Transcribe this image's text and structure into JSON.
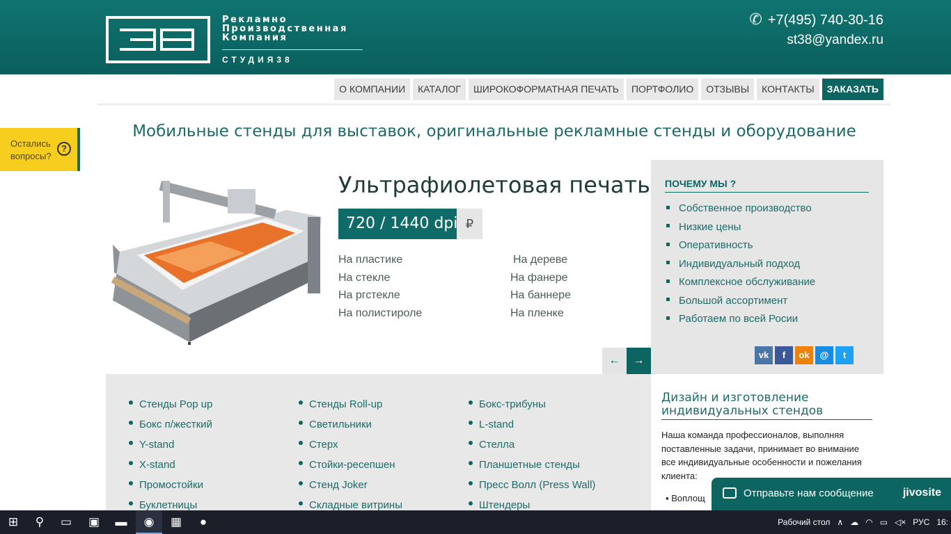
{
  "header": {
    "logo_lines": [
      "Рекламно",
      "Производственная",
      "Компания"
    ],
    "logo_sub": "СТУДИЯ38",
    "phone": "+7(495) 740-30-16",
    "email": "st38@yandex.ru"
  },
  "nav": {
    "items": [
      "О КОМПАНИИ",
      "КАТАЛОГ",
      "ШИРОКОФОРМАТНАЯ ПЕЧАТЬ",
      "ПОРТФОЛИО",
      "ОТЗЫВЫ",
      "КОНТАКТЫ",
      "ЗАКАЗАТЬ"
    ]
  },
  "side_tab": {
    "label_line1": "Остались",
    "label_line2": "вопросы?",
    "icon": "?"
  },
  "headline": "Мобильные стенды для выставок, оригинальные рекламные стенды и оборудование",
  "hero": {
    "title": "Ультрафиолетовая печать",
    "dpi": "720 / 1440 dpi",
    "currency": "₽",
    "materials_col1": [
      "На пластике",
      "На стекле",
      "На ргстекле",
      "На полистироле"
    ],
    "materials_col2": [
      "На дереве",
      "На фанере",
      "На баннере",
      "На пленке"
    ],
    "prev_arrow": "←",
    "next_arrow": "→"
  },
  "why": {
    "title": "ПОЧЕМУ МЫ ?",
    "items": [
      "Собственное производство",
      "Низкие цены",
      "Оперативность",
      "Индивидуальный подход",
      "Комплексное обслуживание",
      "Большой ассортимент",
      "Работаем по всей Росии"
    ],
    "socials": [
      {
        "name": "vk",
        "label": "vk",
        "color": "#4a76a8"
      },
      {
        "name": "facebook",
        "label": "f",
        "color": "#3b5998"
      },
      {
        "name": "odnoklassniki",
        "label": "ok",
        "color": "#ee8208"
      },
      {
        "name": "moimir",
        "label": "@",
        "color": "#168de2"
      },
      {
        "name": "twitter",
        "label": "t",
        "color": "#1da1f2"
      }
    ]
  },
  "catalog": {
    "col1": [
      "Стенды Pop up",
      "Бокс п/жесткий",
      "Y-stand",
      "X-stand",
      "Промостойки",
      "Буклетницы"
    ],
    "col2": [
      "Стенды Roll-up",
      "Светильники",
      "Стерх",
      "Стойки-ресепшен",
      "Стенд Joker",
      "Складные витрины"
    ],
    "col3": [
      "Бокс-трибуны",
      "L-stand",
      "Стелла",
      "Планшетные стенды",
      "Пресс Волл (Press Wall)",
      "Штендеры"
    ]
  },
  "design": {
    "title": "Дизайн и изготовление индивидуальных стендов",
    "text": "Наша команда профессионалов, выполняя поставленные задачи, принимает во внимание все индивидуальные особенности и пожелания клиента:",
    "bullet": "Воплощ"
  },
  "chat": {
    "label": "Отправьте нам сообщение",
    "brand": "jivosite"
  },
  "taskbar": {
    "desktop_label": "Рабочий стол",
    "lang": "РУС",
    "time": "16:"
  }
}
